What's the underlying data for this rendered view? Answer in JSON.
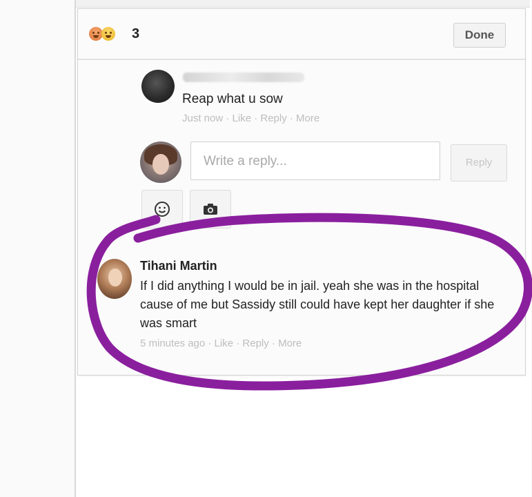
{
  "header": {
    "reaction_icons": [
      "angry-icon",
      "haha-icon"
    ],
    "reaction_count": "3",
    "done_label": "Done"
  },
  "comments": [
    {
      "name": "",
      "name_redacted": true,
      "text": "Reap what u sow",
      "meta": "Just now · Like · Reply · More"
    },
    {
      "name": "Tihani Martin",
      "text": "If I did anything I would be in jail. yeah she was in the hospital cause of me but Sassidy still could have kept her daughter if she was smart",
      "meta": "5 minutes ago · Like · Reply · More"
    }
  ],
  "reply": {
    "placeholder": "Write a reply...",
    "button_label": "Reply",
    "tools": [
      "emoji-icon",
      "camera-icon"
    ]
  },
  "colors": {
    "highlight": "#8a1f9e",
    "meta_text": "#bdbdbd",
    "text": "#222222"
  }
}
